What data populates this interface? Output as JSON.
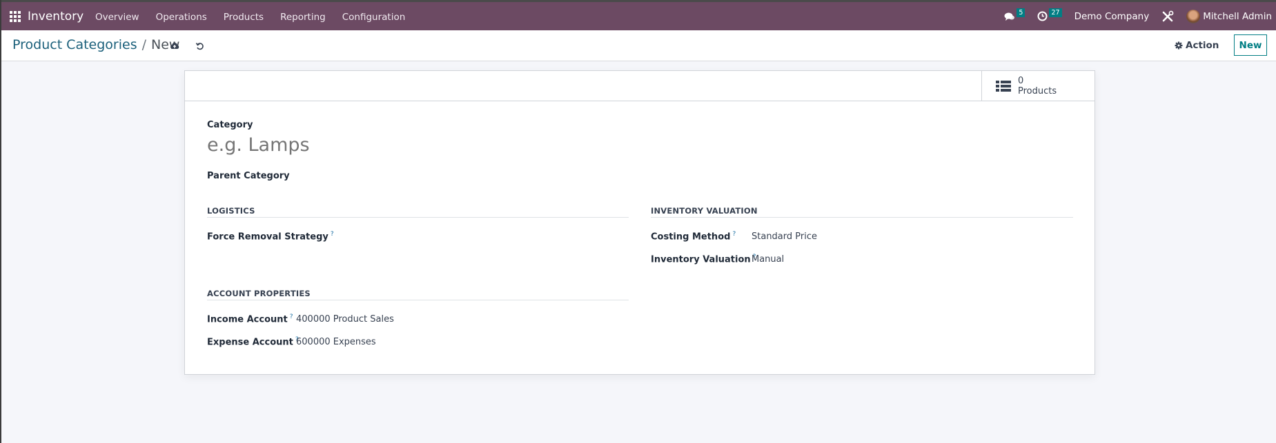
{
  "navbar": {
    "app_name": "Inventory",
    "menu": [
      "Overview",
      "Operations",
      "Products",
      "Reporting",
      "Configuration"
    ],
    "messages_count": "5",
    "activities_count": "27",
    "company": "Demo Company",
    "user": "Mitchell Admin"
  },
  "control_panel": {
    "breadcrumb_parent": "Product Categories",
    "breadcrumb_separator": "/",
    "breadcrumb_current": "New",
    "action_label": "Action",
    "new_label": "New"
  },
  "form": {
    "stat_button": {
      "count": "0",
      "label": "Products"
    },
    "category_label": "Category",
    "category_placeholder": "e.g. Lamps",
    "parent_category_label": "Parent Category",
    "logistics": {
      "title": "LOGISTICS",
      "force_removal_label": "Force Removal Strategy"
    },
    "inventory_valuation": {
      "title": "INVENTORY VALUATION",
      "costing_method_label": "Costing Method",
      "costing_method_value": "Standard Price",
      "valuation_label": "Inventory Valuation",
      "valuation_value": "Manual"
    },
    "account_properties": {
      "title": "ACCOUNT PROPERTIES",
      "income_label": "Income Account",
      "income_value": "400000 Product Sales",
      "expense_label": "Expense Account",
      "expense_value": "600000 Expenses"
    },
    "help_mark": "?"
  },
  "colors": {
    "navbar": "#6c4a63",
    "accent": "#017e84",
    "link": "#1a5f7a"
  }
}
